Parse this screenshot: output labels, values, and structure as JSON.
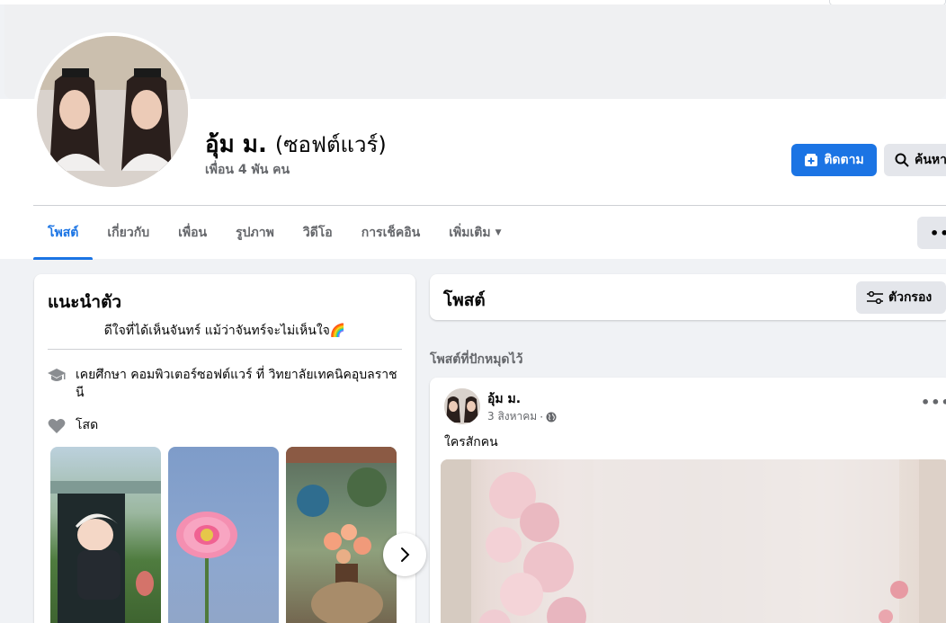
{
  "profile": {
    "name": "อุ้ม ม.",
    "alternate_name": "(ซอฟต์แวร์)",
    "friends": "เพื่อน 4 พัน คน"
  },
  "actions": {
    "follow_label": "ติดตาม",
    "search_label": "ค้นหา",
    "more_label": "•••"
  },
  "tabs": [
    {
      "label": "โพสต์",
      "active": true
    },
    {
      "label": "เกี่ยวกับ"
    },
    {
      "label": "เพื่อน"
    },
    {
      "label": "รูปภาพ"
    },
    {
      "label": "วิดีโอ"
    },
    {
      "label": "การเช็คอิน"
    },
    {
      "label": "เพิ่มเติม",
      "caret": "▼"
    }
  ],
  "intro": {
    "title": "แนะนำตัว",
    "bio": "ดีใจที่ได้เห็นจันทร์ แม้ว่าจันทร์จะไม่เห็นใจ🌈",
    "education": "เคยศึกษา คอมพิวเตอร์ซอฟต์แวร์ ที่ วิทยาลัยเทคนิคอุบลราชนี",
    "relationship": "โสด"
  },
  "posts": {
    "title": "โพสต์",
    "filter_label": "ตัวกรอง",
    "pinned_label": "โพสต์ที่ปักหมุดไว้"
  },
  "post": {
    "author": "อุ้ม ม.",
    "date": "3 สิงหาคม",
    "separator": "·",
    "text": "ใครสักคน",
    "menu": "•••"
  },
  "colors": {
    "accent": "#1b74e4",
    "background": "#f0f2f5",
    "secondary_text": "#65676b"
  }
}
